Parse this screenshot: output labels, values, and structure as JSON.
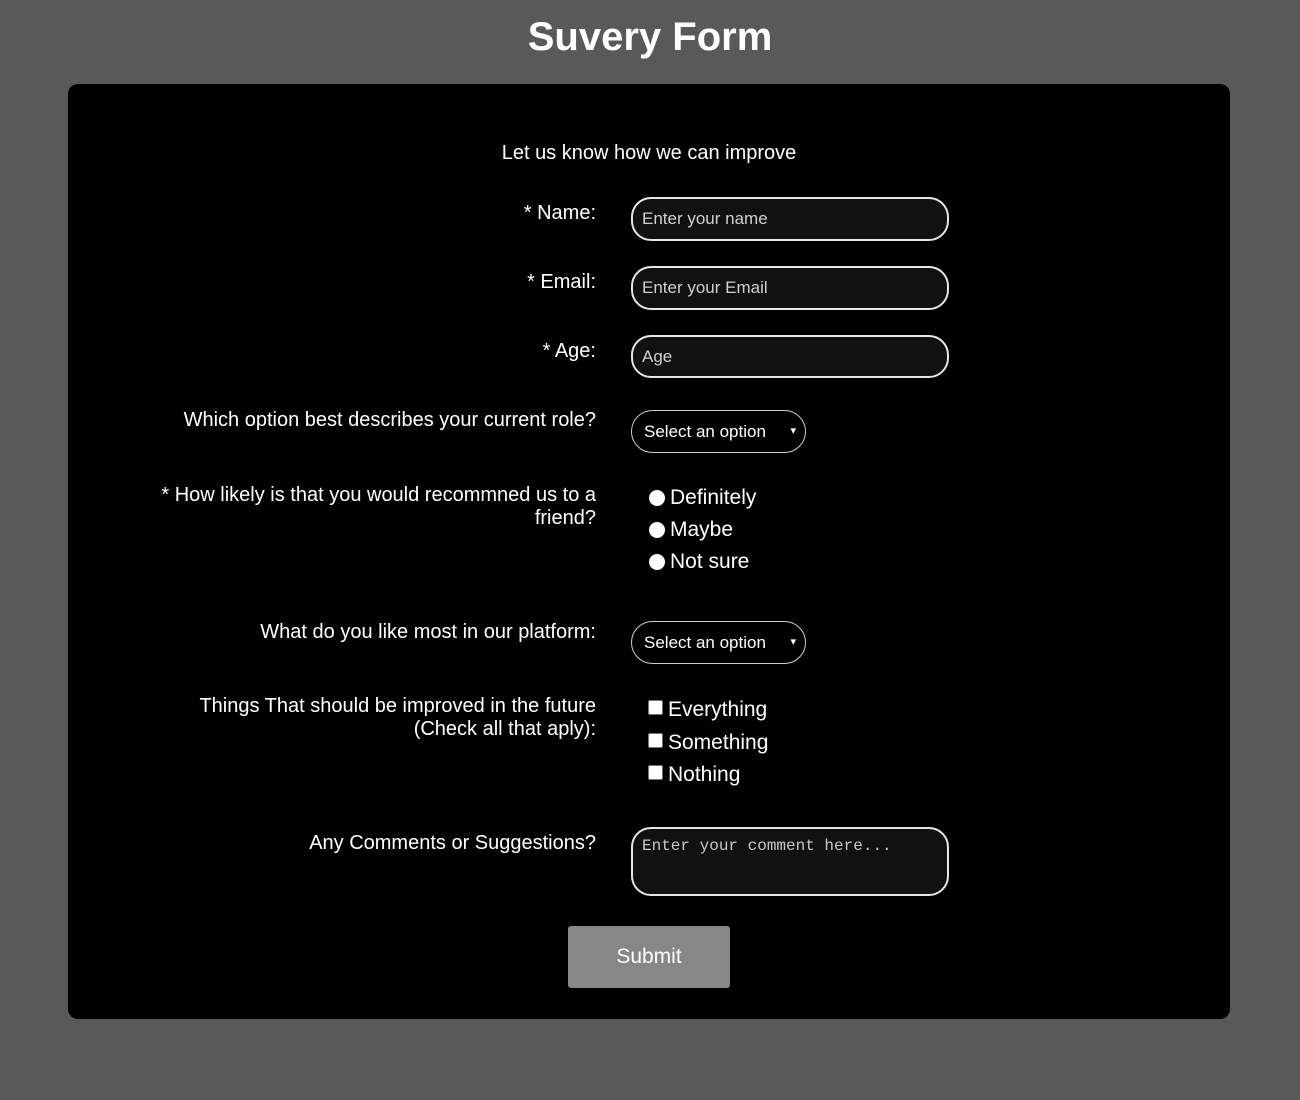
{
  "page": {
    "title": "Suvery Form"
  },
  "form": {
    "subtitle": "Let us know how we can improve",
    "name": {
      "label": "* Name:",
      "placeholder": "Enter your name"
    },
    "email": {
      "label": "* Email:",
      "placeholder": "Enter your Email"
    },
    "age": {
      "label": "* Age:",
      "placeholder": "Age"
    },
    "role": {
      "label": "Which option best describes your current role?",
      "selected": "Select an option"
    },
    "recommend": {
      "label_line1": "* How likely is that you would recommned us to a",
      "label_line2": "friend?",
      "options": [
        "Definitely",
        "Maybe",
        "Not sure"
      ]
    },
    "platform": {
      "label": "What do you like most in our platform:",
      "selected": "Select an option"
    },
    "improve": {
      "label_line1": "Things That should be improved in the future",
      "label_line2": "(Check all that aply):",
      "options": [
        "Everything",
        "Something",
        "Nothing"
      ]
    },
    "comments": {
      "label": "Any Comments or Suggestions?",
      "placeholder": "Enter your comment here..."
    },
    "submit_label": "Submit"
  },
  "icons": {
    "select_chevron": "chevron-down-icon"
  }
}
